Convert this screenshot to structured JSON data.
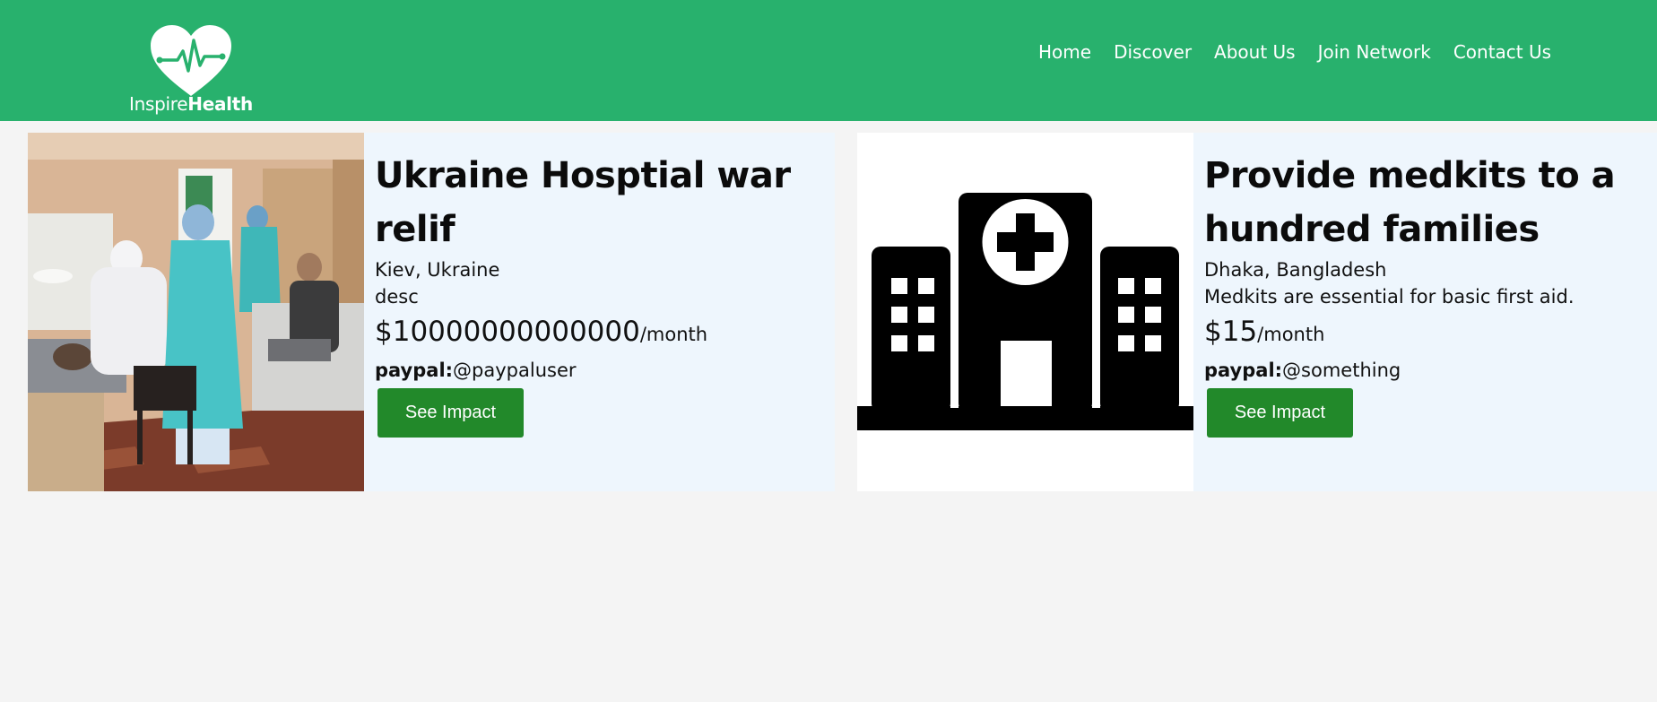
{
  "brand": {
    "name_light": "Inspire",
    "name_bold": "Health",
    "color": "#28b16d"
  },
  "nav": {
    "items": [
      {
        "label": "Home"
      },
      {
        "label": "Discover"
      },
      {
        "label": "About Us"
      },
      {
        "label": "Join Network"
      },
      {
        "label": "Contact Us"
      }
    ]
  },
  "cards": [
    {
      "image": "ukraine-hospital-photo",
      "title": "Ukraine Hosptial war relif",
      "location": "Kiev, Ukraine",
      "description": "desc",
      "amount": "$10000000000000",
      "period": "/month",
      "paypal_label": "paypal:",
      "paypal_handle": "@paypaluser",
      "button_label": "See Impact"
    },
    {
      "image": "hospital-building-icon",
      "title": "Provide medkits to a hundred families",
      "location": "Dhaka, Bangladesh",
      "description": "Medkits are essential for basic first aid.",
      "amount": "$15",
      "period": "/month",
      "paypal_label": "paypal:",
      "paypal_handle": "@something",
      "button_label": "See Impact"
    }
  ],
  "colors": {
    "button": "#22892a",
    "card_background": "#eef6fd",
    "page_background": "#f4f4f4"
  }
}
